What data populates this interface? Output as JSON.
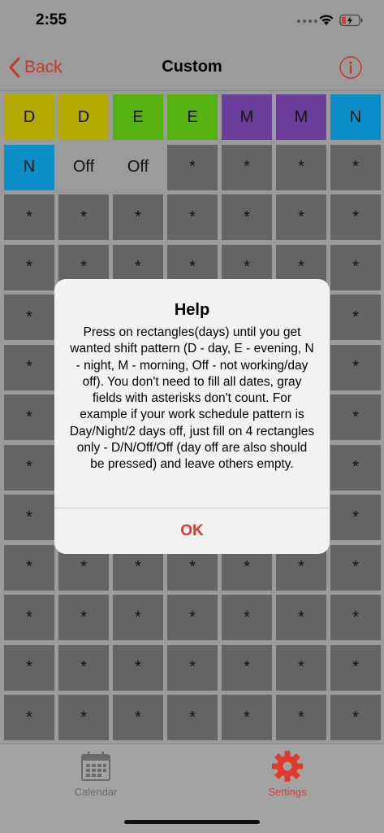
{
  "status_bar": {
    "time": "2:55"
  },
  "nav": {
    "back_label": "Back",
    "title": "Custom"
  },
  "grid": {
    "rows": [
      [
        {
          "label": "D",
          "color": "#b3aa00"
        },
        {
          "label": "D",
          "color": "#b3aa00"
        },
        {
          "label": "E",
          "color": "#55b10f"
        },
        {
          "label": "E",
          "color": "#55b10f"
        },
        {
          "label": "M",
          "color": "#6a3e9a"
        },
        {
          "label": "M",
          "color": "#6a3e9a"
        },
        {
          "label": "N",
          "color": "#0c8fc8"
        }
      ],
      [
        {
          "label": "N",
          "color": "#0c8fc8"
        },
        {
          "label": "Off",
          "color": "off"
        },
        {
          "label": "Off",
          "color": "off"
        },
        {
          "label": "*",
          "color": "empty"
        },
        {
          "label": "*",
          "color": "empty"
        },
        {
          "label": "*",
          "color": "empty"
        },
        {
          "label": "*",
          "color": "empty"
        }
      ],
      [
        {
          "label": "*",
          "color": "empty"
        },
        {
          "label": "*",
          "color": "empty"
        },
        {
          "label": "*",
          "color": "empty"
        },
        {
          "label": "*",
          "color": "empty"
        },
        {
          "label": "*",
          "color": "empty"
        },
        {
          "label": "*",
          "color": "empty"
        },
        {
          "label": "*",
          "color": "empty"
        }
      ],
      [
        {
          "label": "*",
          "color": "empty"
        },
        {
          "label": "*",
          "color": "empty"
        },
        {
          "label": "*",
          "color": "empty"
        },
        {
          "label": "*",
          "color": "empty"
        },
        {
          "label": "*",
          "color": "empty"
        },
        {
          "label": "*",
          "color": "empty"
        },
        {
          "label": "*",
          "color": "empty"
        }
      ],
      [
        {
          "label": "*",
          "color": "empty"
        },
        {
          "label": "*",
          "color": "empty"
        },
        {
          "label": "*",
          "color": "empty"
        },
        {
          "label": "*",
          "color": "empty"
        },
        {
          "label": "*",
          "color": "empty"
        },
        {
          "label": "*",
          "color": "empty"
        },
        {
          "label": "*",
          "color": "empty"
        }
      ],
      [
        {
          "label": "*",
          "color": "empty"
        },
        {
          "label": "*",
          "color": "empty"
        },
        {
          "label": "*",
          "color": "empty"
        },
        {
          "label": "*",
          "color": "empty"
        },
        {
          "label": "*",
          "color": "empty"
        },
        {
          "label": "*",
          "color": "empty"
        },
        {
          "label": "*",
          "color": "empty"
        }
      ],
      [
        {
          "label": "*",
          "color": "empty"
        },
        {
          "label": "*",
          "color": "empty"
        },
        {
          "label": "*",
          "color": "empty"
        },
        {
          "label": "*",
          "color": "empty"
        },
        {
          "label": "*",
          "color": "empty"
        },
        {
          "label": "*",
          "color": "empty"
        },
        {
          "label": "*",
          "color": "empty"
        }
      ],
      [
        {
          "label": "*",
          "color": "empty"
        },
        {
          "label": "*",
          "color": "empty"
        },
        {
          "label": "*",
          "color": "empty"
        },
        {
          "label": "*",
          "color": "empty"
        },
        {
          "label": "*",
          "color": "empty"
        },
        {
          "label": "*",
          "color": "empty"
        },
        {
          "label": "*",
          "color": "empty"
        }
      ],
      [
        {
          "label": "*",
          "color": "empty"
        },
        {
          "label": "*",
          "color": "empty"
        },
        {
          "label": "*",
          "color": "empty"
        },
        {
          "label": "*",
          "color": "empty"
        },
        {
          "label": "*",
          "color": "empty"
        },
        {
          "label": "*",
          "color": "empty"
        },
        {
          "label": "*",
          "color": "empty"
        }
      ],
      [
        {
          "label": "*",
          "color": "empty"
        },
        {
          "label": "*",
          "color": "empty"
        },
        {
          "label": "*",
          "color": "empty"
        },
        {
          "label": "*",
          "color": "empty"
        },
        {
          "label": "*",
          "color": "empty"
        },
        {
          "label": "*",
          "color": "empty"
        },
        {
          "label": "*",
          "color": "empty"
        }
      ],
      [
        {
          "label": "*",
          "color": "empty"
        },
        {
          "label": "*",
          "color": "empty"
        },
        {
          "label": "*",
          "color": "empty"
        },
        {
          "label": "*",
          "color": "empty"
        },
        {
          "label": "*",
          "color": "empty"
        },
        {
          "label": "*",
          "color": "empty"
        },
        {
          "label": "*",
          "color": "empty"
        }
      ],
      [
        {
          "label": "*",
          "color": "empty"
        },
        {
          "label": "*",
          "color": "empty"
        },
        {
          "label": "*",
          "color": "empty"
        },
        {
          "label": "*",
          "color": "empty"
        },
        {
          "label": "*",
          "color": "empty"
        },
        {
          "label": "*",
          "color": "empty"
        },
        {
          "label": "*",
          "color": "empty"
        }
      ],
      [
        {
          "label": "*",
          "color": "empty"
        },
        {
          "label": "*",
          "color": "empty"
        },
        {
          "label": "*",
          "color": "empty"
        },
        {
          "label": "*",
          "color": "empty"
        },
        {
          "label": "*",
          "color": "empty"
        },
        {
          "label": "*",
          "color": "empty"
        },
        {
          "label": "*",
          "color": "empty"
        }
      ]
    ]
  },
  "alert": {
    "title": "Help",
    "message": "Press on rectangles(days) until you get wanted shift pattern (D - day, E - evening, N - night, M - morning, Off - not working/day off). You don't need to fill all dates, gray fields with asterisks don't count. For example if your work schedule pattern is Day/Night/2 days off, just fill on 4 rectangles only - D/N/Off/Off (day off are also should be pressed) and leave others empty.",
    "ok_label": "OK"
  },
  "tab_bar": {
    "tabs": [
      {
        "label": "Calendar",
        "icon": "calendar-icon",
        "active": false
      },
      {
        "label": "Settings",
        "icon": "gear-icon",
        "active": true
      }
    ]
  },
  "colors": {
    "accent": "#e03a2f",
    "inactive_tab": "#6b6b6b",
    "empty_cell": "#646464"
  }
}
